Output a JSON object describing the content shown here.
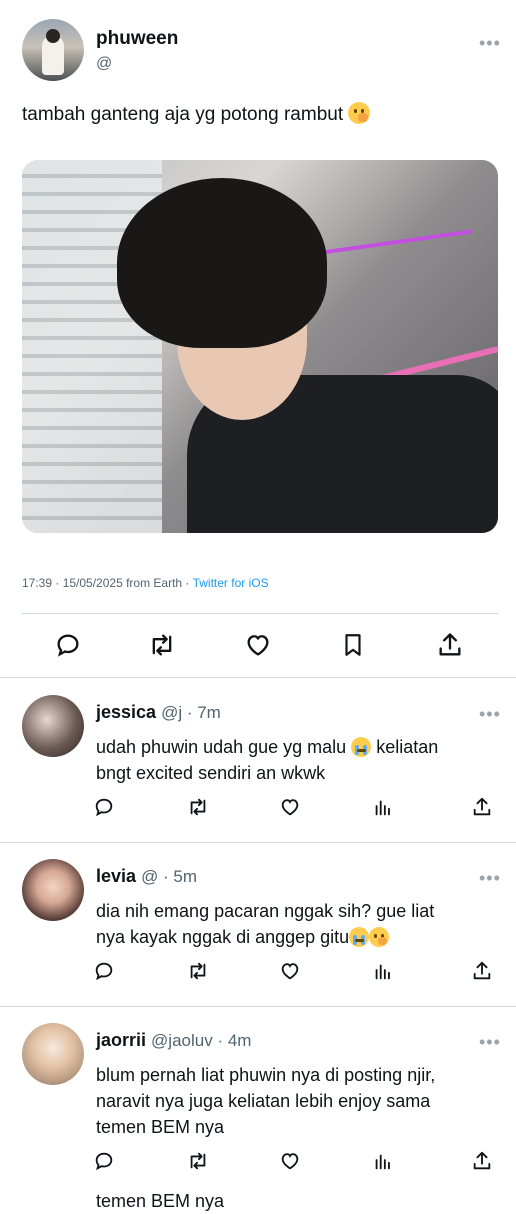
{
  "tweet": {
    "author_name": "phuween",
    "author_handle": "@",
    "text": "tambah ganteng aja yg potong rambut",
    "emoji": "shushing-face-emoji",
    "meta_time": "17:39 · 15/05/2025 from Earth · ",
    "meta_source": "Twitter for iOS"
  },
  "icons": {
    "reply": "reply-icon",
    "retweet": "retweet-icon",
    "like": "like-icon",
    "bookmark": "bookmark-icon",
    "share": "share-icon",
    "views": "views-icon",
    "more": "more-icon"
  },
  "more_label": "•••",
  "replies": [
    {
      "name": "jessica",
      "handle": "@j · 7m",
      "line1": "udah phuwin udah gue yg malu ",
      "line1b": " keliatan",
      "line2": "bngt excited sendiri an wkwk"
    },
    {
      "name": "levia",
      "handle": "@ · 5m",
      "line1": "dia nih emang pacaran nggak sih? gue liat",
      "line2": "nya kayak nggak di anggep gitu"
    },
    {
      "name": "jaorrii",
      "handle": "@jaoluv · 4m",
      "line1": "blum pernah liat phuwin nya di posting njir,",
      "line2": "naravit nya juga keliatan lebih enjoy sama",
      "line3": "temen BEM nya"
    }
  ],
  "cutoff_text": "temen BEM nya",
  "colors": {
    "accent": "#1d9bf0",
    "secondary_text": "#536471",
    "divider": "#cfd9de"
  }
}
